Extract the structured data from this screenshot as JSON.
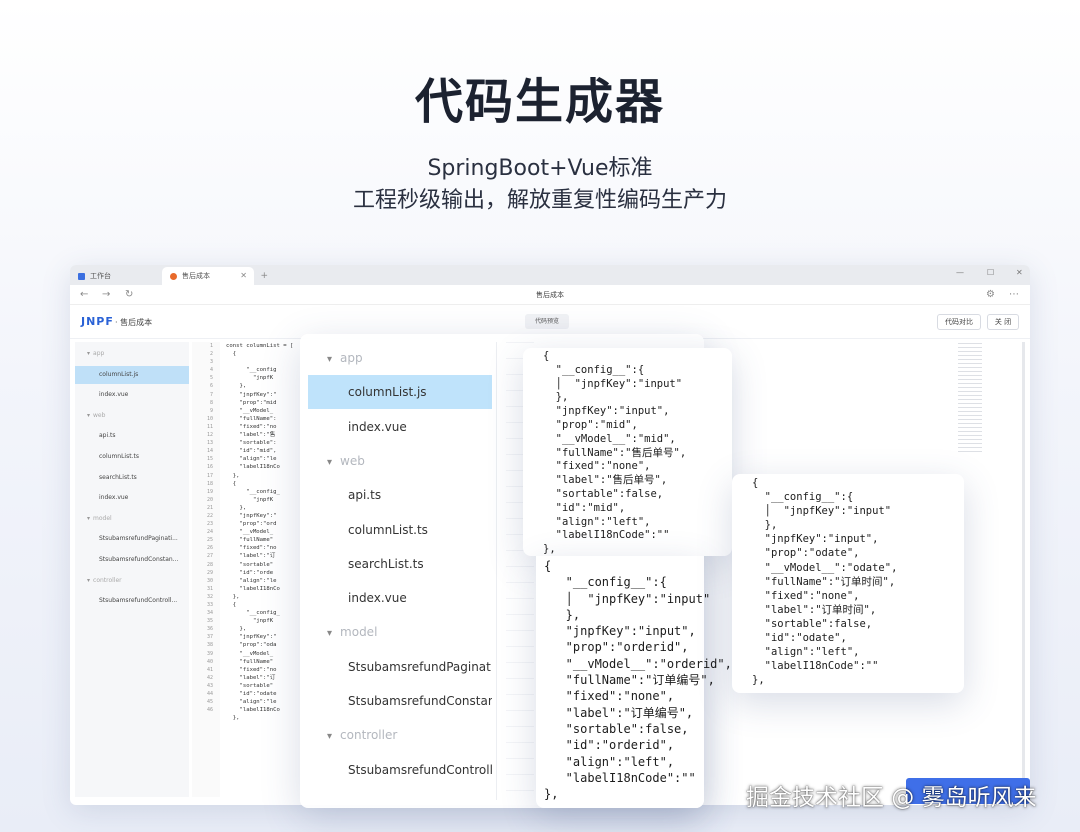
{
  "hero": {
    "title": "代码生成器",
    "subtitle1": "SpringBoot+Vue标准",
    "subtitle2": "工程秒级输出，解放重复性编码生产力"
  },
  "browser": {
    "tabs": [
      {
        "label": "工作台"
      },
      {
        "label": "售后成本"
      }
    ],
    "nav_title": "售后成本",
    "window_controls": [
      "—",
      "☐",
      "✕"
    ]
  },
  "app": {
    "logo": "JNPF",
    "logo_accent": "",
    "crumb": "售后成本",
    "center_pill": "代码预览",
    "btn_compare": "代码对比",
    "btn_close": "关 闭"
  },
  "tree_small": [
    {
      "label": "app",
      "folder": true
    },
    {
      "label": "columnList.js",
      "active": true
    },
    {
      "label": "index.vue"
    },
    {
      "label": "web",
      "folder": true
    },
    {
      "label": "api.ts"
    },
    {
      "label": "columnList.ts"
    },
    {
      "label": "searchList.ts"
    },
    {
      "label": "index.vue"
    },
    {
      "label": "model",
      "folder": true
    },
    {
      "label": "StsubamsrefundPaginati..."
    },
    {
      "label": "StsubamsrefundConstan..."
    },
    {
      "label": "controller",
      "folder": true
    },
    {
      "label": "StsubamsrefundControll..."
    }
  ],
  "tree_large": [
    {
      "label": "app",
      "folder": true
    },
    {
      "label": "columnList.js",
      "active": true
    },
    {
      "label": "index.vue"
    },
    {
      "label": "web",
      "folder": true
    },
    {
      "label": "api.ts"
    },
    {
      "label": "columnList.ts"
    },
    {
      "label": "searchList.ts"
    },
    {
      "label": "index.vue"
    },
    {
      "label": "model",
      "folder": true
    },
    {
      "label": "StsubamsrefundPaginati..."
    },
    {
      "label": "StsubamsrefundConstan..."
    },
    {
      "label": "controller",
      "folder": true
    },
    {
      "label": "StsubamsrefundControll..."
    }
  ],
  "code_small": {
    "line_start": 1,
    "line_end": 46,
    "text": "const columnList = [\n  {\n\n      \"__config\n        \"jnpfK\n    },\n    \"jnpfKey\":\"\n    \"prop\":\"mid\n    \"__vModel_\n    \"fullName\":\n    \"fixed\":\"no\n    \"label\":\"售\n    \"sortable\":\n    \"id\":\"mid\",\n    \"align\":\"le\n    \"labelI18nCo\n  },\n  {\n      \"__config_\n        \"jnpfK\n    },\n    \"jnpfKey\":\"\n    \"prop\":\"ord\n    \"__vModel_\n    \"fullName\"\n    \"fixed\":\"no\n    \"label\":\"订\n    \"sortable\"\n    \"id\":\"orde\n    \"align\":\"le\n    \"labelI18nCo\n  },\n  {\n      \"__config_\n        \"jnpfK\n    },\n    \"jnpfKey\":\"\n    \"prop\":\"oda\n    \"__vModel_\n    \"fullName\"\n    \"fixed\":\"no\n    \"label\":\"订\n    \"sortable\"\n    \"id\":\"odate\n    \"align\":\"le\n    \"labelI18nCo\n  },"
  },
  "code_card1": "{\n  \"__config__\":{\n  │  \"jnpfKey\":\"input\"\n  },\n  \"jnpfKey\":\"input\",\n  \"prop\":\"mid\",\n  \"__vModel__\":\"mid\",\n  \"fullName\":\"售后单号\",\n  \"fixed\":\"none\",\n  \"label\":\"售后单号\",\n  \"sortable\":false,\n  \"id\":\"mid\",\n  \"align\":\"left\",\n  \"labelI18nCode\":\"\"\n},",
  "code_card2": "{\n   \"__config__\":{\n   │  \"jnpfKey\":\"input\"\n   },\n   \"jnpfKey\":\"input\",\n   \"prop\":\"orderid\",\n   \"__vModel__\":\"orderid\",\n   \"fullName\":\"订单编号\",\n   \"fixed\":\"none\",\n   \"label\":\"订单编号\",\n   \"sortable\":false,\n   \"id\":\"orderid\",\n   \"align\":\"left\",\n   \"labelI18nCode\":\"\"\n},",
  "code_card3": "{\n  \"__config__\":{\n  │  \"jnpfKey\":\"input\"\n  },\n  \"jnpfKey\":\"input\",\n  \"prop\":\"odate\",\n  \"__vModel__\":\"odate\",\n  \"fullName\":\"订单时间\",\n  \"fixed\":\"none\",\n  \"label\":\"订单时间\",\n  \"sortable\":false,\n  \"id\":\"odate\",\n  \"align\":\"left\",\n  \"labelI18nCode\":\"\"\n},",
  "watermark": "掘金技术社区 @ 雾岛听风来",
  "colors": {
    "accent": "#2a62d6",
    "active_row": "#bfe3fb",
    "corner_blue": "#3f6fe8"
  }
}
